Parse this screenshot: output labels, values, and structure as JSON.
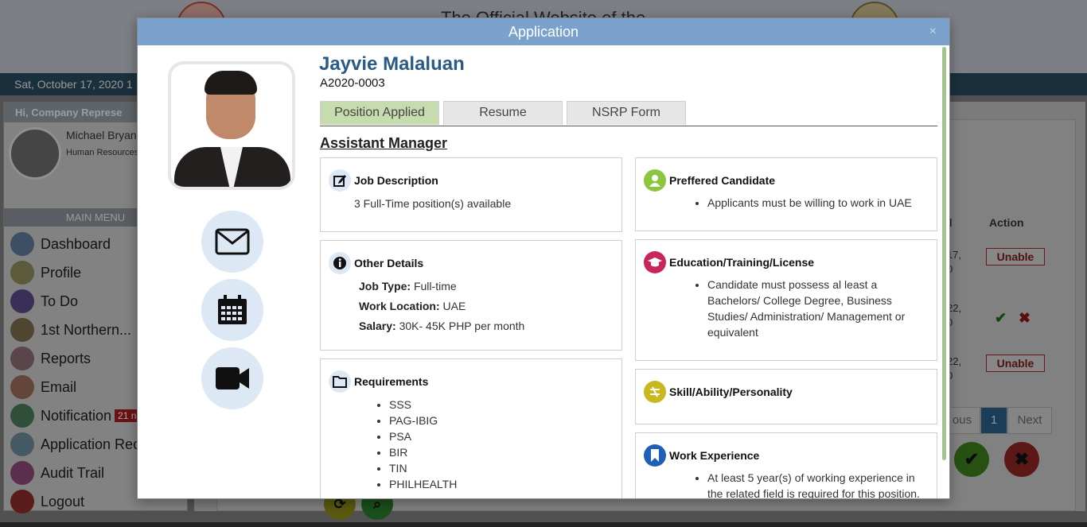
{
  "background": {
    "site_title": "The Official Website of the",
    "date_text": "Sat, October 17, 2020 1",
    "greeting": "Hi, Company Represe",
    "user_name": "Michael Bryan",
    "user_role": "Human Resources",
    "menu_header": "MAIN MENU",
    "menu": [
      {
        "label": "Dashboard",
        "color": "#5e7a98"
      },
      {
        "label": "Profile",
        "color": "#8e8a5a"
      },
      {
        "label": "To Do",
        "color": "#5a4a86"
      },
      {
        "label": "1st Northern...",
        "color": "#7a6b4a"
      },
      {
        "label": "Reports",
        "color": "#8a6a72"
      },
      {
        "label": "Email",
        "color": "#9a6a58"
      },
      {
        "label": "Notification",
        "color": "#4a7a5a"
      },
      {
        "label": "Application Rec",
        "color": "#6a8a9a"
      },
      {
        "label": "Audit Trail",
        "color": "#8a4a78"
      },
      {
        "label": "Logout",
        "color": "#8a2a2a"
      }
    ],
    "notification_badge": "21 n",
    "table_headers": {
      "col1": "d",
      "col2": "Action"
    },
    "rows": [
      {
        "date_line1": "r 17,",
        "date_line2": "0",
        "action": "Unable"
      },
      {
        "date_line1": "22,",
        "date_line2": "0",
        "action": ""
      },
      {
        "date_line1": "22,",
        "date_line2": "0",
        "action": "Unable"
      }
    ],
    "pager": {
      "prev": "ous",
      "current": "1",
      "next": "Next"
    }
  },
  "modal": {
    "title": "Application",
    "close_icon": "×",
    "applicant_name": "Jayvie Malaluan",
    "applicant_id": "A2020-0003",
    "tabs": [
      {
        "label": "Position Applied",
        "active": true
      },
      {
        "label": "Resume",
        "active": false
      },
      {
        "label": "NSRP Form",
        "active": false
      }
    ],
    "position_title": "Assistant Manager",
    "job_description": {
      "title": "Job Description",
      "text": "3 Full-Time position(s) available"
    },
    "other_details": {
      "title": "Other Details",
      "job_type_label": "Job Type:",
      "job_type": "Full-time",
      "work_location_label": "Work Location:",
      "work_location": "UAE",
      "salary_label": "Salary:",
      "salary": "30K- 45K PHP per month"
    },
    "requirements": {
      "title": "Requirements",
      "items": [
        "SSS",
        "PAG-IBIG",
        "PSA",
        "BIR",
        "TIN",
        "PHILHEALTH"
      ]
    },
    "preferred_candidate": {
      "title": "Preffered Candidate",
      "items": [
        "Applicants must be willing to work in UAE"
      ]
    },
    "education": {
      "title": "Education/Training/License",
      "items": [
        "Candidate must possess al least a Bachelors/ College Degree, Business Studies/ Administration/ Management or equivalent"
      ]
    },
    "skill": {
      "title": "Skill/Ability/Personality"
    },
    "work_experience": {
      "title": "Work Experience",
      "items": [
        "At least 5 year(s) of working experience in the related field is required for this position."
      ]
    }
  }
}
